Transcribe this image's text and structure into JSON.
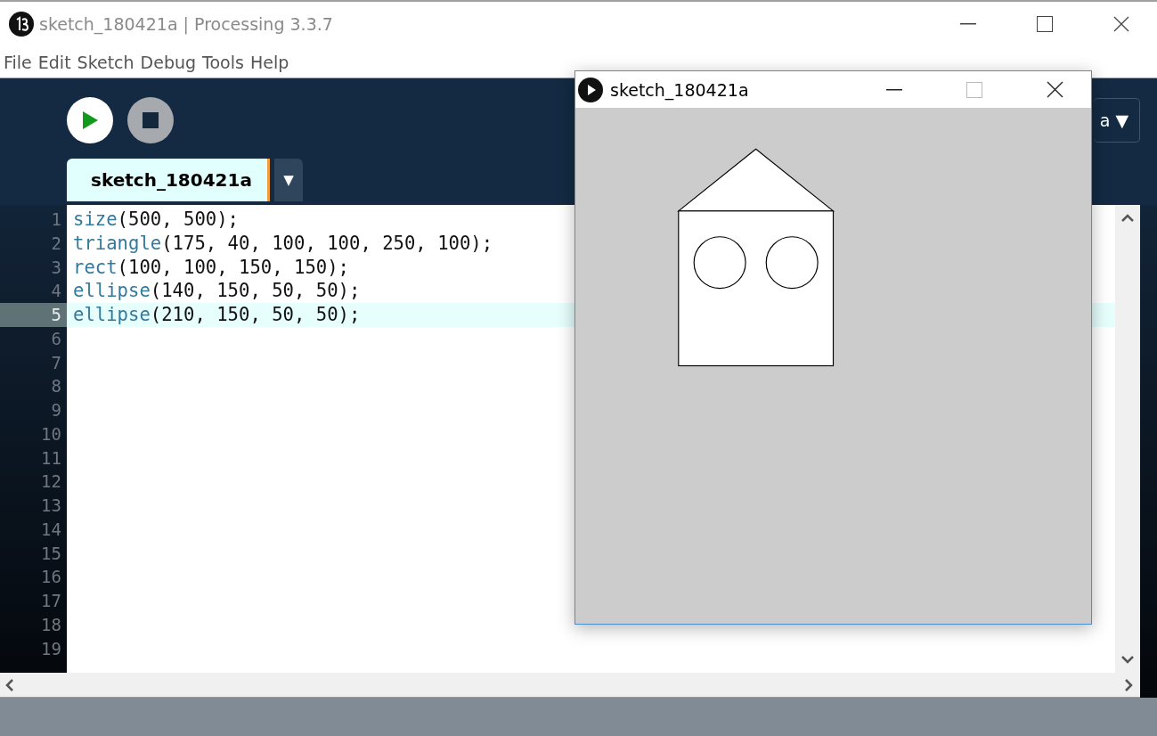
{
  "window": {
    "title": "sketch_180421a | Processing 3.3.7"
  },
  "menu": [
    "File",
    "Edit",
    "Sketch",
    "Debug",
    "Tools",
    "Help"
  ],
  "toolbar": {
    "mode_button": "a ▼"
  },
  "tabs": [
    {
      "label": "sketch_180421a",
      "selected": true
    }
  ],
  "tab_menu": "▼",
  "editor": {
    "lines": [
      {
        "number": "1",
        "text": "size(500, 500);",
        "selected": false
      },
      {
        "number": "2",
        "text": "triangle(175, 40, 100, 100, 250, 100);",
        "selected": false
      },
      {
        "number": "3",
        "text": "rect(100, 100, 150, 150);",
        "selected": false
      },
      {
        "number": "4",
        "text": "ellipse(140, 150, 50, 50);",
        "selected": false
      },
      {
        "number": "5",
        "text": "ellipse(210, 150, 50, 50);",
        "selected": true
      },
      {
        "number": "6",
        "selected": false
      },
      {
        "number": "7",
        "selected": false
      },
      {
        "number": "8",
        "selected": false
      },
      {
        "number": "9",
        "selected": false
      },
      {
        "number": "10",
        "selected": false
      },
      {
        "number": "11",
        "selected": false
      },
      {
        "number": "12",
        "selected": false
      },
      {
        "number": "13",
        "selected": false
      },
      {
        "number": "14",
        "selected": false
      },
      {
        "number": "15",
        "selected": false
      },
      {
        "number": "16",
        "selected": false
      },
      {
        "number": "17",
        "selected": false
      },
      {
        "number": "18",
        "selected": false
      },
      {
        "number": "19",
        "selected": false
      }
    ]
  },
  "sketch_window": {
    "title": "sketch_180421a"
  }
}
